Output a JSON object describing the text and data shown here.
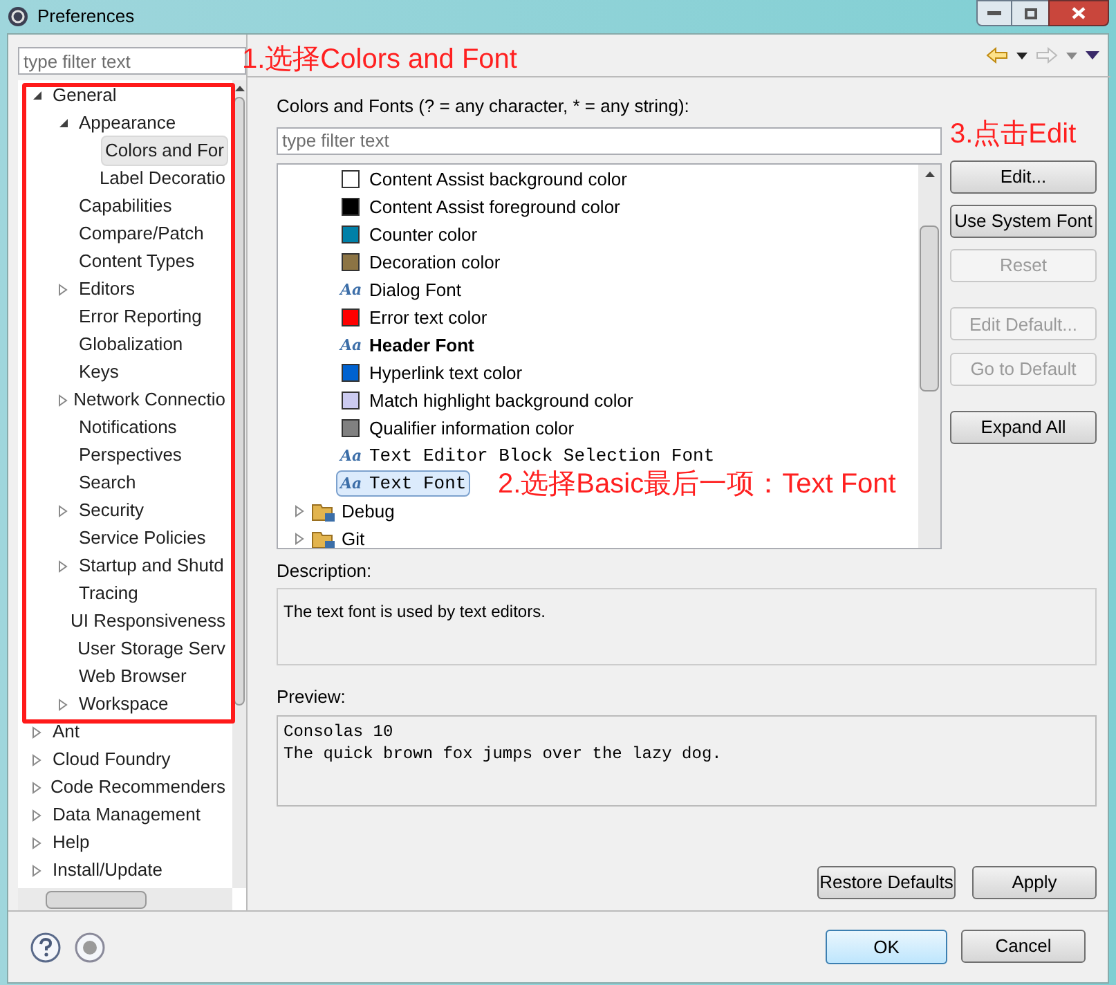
{
  "window": {
    "title": "Preferences"
  },
  "nav": {
    "filter_placeholder": "type filter text",
    "tree": [
      {
        "label": "General",
        "expanded": true,
        "selected": false,
        "children": [
          {
            "label": "Appearance",
            "expanded": true,
            "selected": false,
            "children": [
              {
                "label": "Colors and For",
                "selected": true
              },
              {
                "label": "Label Decoratio",
                "selected": false
              }
            ]
          },
          {
            "label": "Capabilities",
            "selected": false
          },
          {
            "label": "Compare/Patch",
            "selected": false
          },
          {
            "label": "Content Types",
            "selected": false
          },
          {
            "label": "Editors",
            "expanded": false,
            "selected": false
          },
          {
            "label": "Error Reporting",
            "selected": false
          },
          {
            "label": "Globalization",
            "selected": false
          },
          {
            "label": "Keys",
            "selected": false
          },
          {
            "label": "Network Connectio",
            "expanded": false,
            "selected": false
          },
          {
            "label": "Notifications",
            "selected": false
          },
          {
            "label": "Perspectives",
            "selected": false
          },
          {
            "label": "Search",
            "selected": false
          },
          {
            "label": "Security",
            "expanded": false,
            "selected": false
          },
          {
            "label": "Service Policies",
            "selected": false
          },
          {
            "label": "Startup and Shutd",
            "expanded": false,
            "selected": false
          },
          {
            "label": "Tracing",
            "selected": false
          },
          {
            "label": "UI Responsiveness",
            "selected": false
          },
          {
            "label": "User Storage Serv",
            "selected": false
          },
          {
            "label": "Web Browser",
            "selected": false
          },
          {
            "label": "Workspace",
            "expanded": false,
            "selected": false
          }
        ]
      },
      {
        "label": "Ant",
        "expanded": false,
        "selected": false
      },
      {
        "label": "Cloud Foundry",
        "expanded": false,
        "selected": false
      },
      {
        "label": "Code Recommenders",
        "expanded": false,
        "selected": false
      },
      {
        "label": "Data Management",
        "expanded": false,
        "selected": false
      },
      {
        "label": "Help",
        "expanded": false,
        "selected": false
      },
      {
        "label": "Install/Update",
        "expanded": false,
        "selected": false
      }
    ]
  },
  "page": {
    "filter_label": "Colors and Fonts (? = any character, * = any string):",
    "filter_placeholder": "type filter text",
    "items": [
      {
        "kind": "color",
        "label": "Content Assist background color",
        "color": "#ffffff",
        "selected": false
      },
      {
        "kind": "color",
        "label": "Content Assist foreground color",
        "color": "#000000",
        "selected": false
      },
      {
        "kind": "color",
        "label": "Counter color",
        "color": "#0080a8",
        "selected": false
      },
      {
        "kind": "color",
        "label": "Decoration color",
        "color": "#8c7444",
        "selected": false
      },
      {
        "kind": "font",
        "icon": "Aa",
        "label": "Dialog Font",
        "bold": false,
        "monospace": false,
        "selected": false
      },
      {
        "kind": "color",
        "label": "Error text color",
        "color": "#ff0000",
        "selected": false
      },
      {
        "kind": "font",
        "icon": "Aa",
        "label": "Header Font",
        "bold": true,
        "monospace": false,
        "selected": false
      },
      {
        "kind": "color",
        "label": "Hyperlink text color",
        "color": "#0062d0",
        "selected": false
      },
      {
        "kind": "color",
        "label": "Match highlight background color",
        "color": "#cccbf0",
        "selected": false
      },
      {
        "kind": "color",
        "label": "Qualifier information color",
        "color": "#808080",
        "selected": false
      },
      {
        "kind": "font",
        "icon": "Aa",
        "label": "Text Editor Block Selection Font",
        "bold": false,
        "monospace": true,
        "selected": false
      },
      {
        "kind": "font",
        "icon": "Aa",
        "label": "Text Font",
        "bold": false,
        "monospace": true,
        "selected": true
      },
      {
        "kind": "category",
        "label": "Debug"
      },
      {
        "kind": "category",
        "label": "Git"
      }
    ],
    "buttons": [
      {
        "label": "Edit...",
        "disabled": false
      },
      {
        "label": "Use System Font",
        "disabled": false
      },
      {
        "label": "Reset",
        "disabled": true
      },
      {
        "label": "Edit Default...",
        "disabled": true
      },
      {
        "label": "Go to Default",
        "disabled": true
      },
      {
        "label": "Expand All",
        "disabled": false
      }
    ],
    "description_label": "Description:",
    "description": "The text font is used by text editors.",
    "preview_label": "Preview:",
    "preview_lines": [
      "Consolas 10",
      "The quick brown fox jumps over the lazy dog."
    ],
    "restore_button": "Restore Defaults",
    "apply_button": "Apply"
  },
  "footer": {
    "ok_button": "OK",
    "cancel_button": "Cancel"
  },
  "annotations": [
    "1.选择Colors and Font",
    "2.选择Basic最后一项：Text Font",
    "3.点击Edit"
  ]
}
